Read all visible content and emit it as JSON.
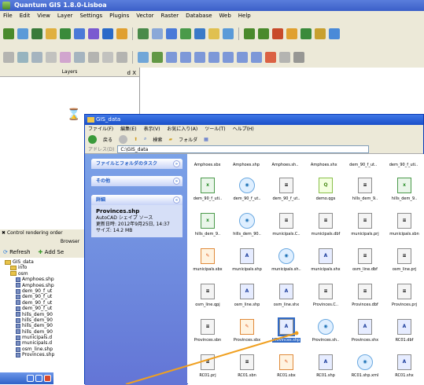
{
  "qgis": {
    "title": "Quantum GIS 1.8.0-Lisboa",
    "menu": [
      "File",
      "Edit",
      "View",
      "Layer",
      "Settings",
      "Plugins",
      "Vector",
      "Raster",
      "Database",
      "Web",
      "Help"
    ],
    "layers_title": "Layers",
    "layers_ctrl": "d X",
    "control_rendering": "Control rendering order",
    "browser_title": "Browser",
    "browser_refresh": "Refresh",
    "browser_add": "Add Se",
    "tree": [
      {
        "indent": 0,
        "label": "GIS_data",
        "kind": "folder"
      },
      {
        "indent": 1,
        "label": "info",
        "kind": "folder"
      },
      {
        "indent": 1,
        "label": "osm",
        "kind": "folder"
      },
      {
        "indent": 2,
        "label": "Amphoes.shp",
        "kind": "file"
      },
      {
        "indent": 2,
        "label": "Amphoes.shp",
        "kind": "file"
      },
      {
        "indent": 2,
        "label": "dem_90_f_ut",
        "kind": "file"
      },
      {
        "indent": 2,
        "label": "dem_90_f_ut",
        "kind": "file"
      },
      {
        "indent": 2,
        "label": "dem_90_f_ut",
        "kind": "file"
      },
      {
        "indent": 2,
        "label": "dem_90_f_ut",
        "kind": "file"
      },
      {
        "indent": 2,
        "label": "hills_dem_90",
        "kind": "file"
      },
      {
        "indent": 2,
        "label": "hills_dem_90",
        "kind": "file"
      },
      {
        "indent": 2,
        "label": "hills_dem_90",
        "kind": "file"
      },
      {
        "indent": 2,
        "label": "hills_dem_90",
        "kind": "file"
      },
      {
        "indent": 2,
        "label": "municipals.d",
        "kind": "file"
      },
      {
        "indent": 2,
        "label": "municipals.d",
        "kind": "file"
      },
      {
        "indent": 2,
        "label": "osm_line.shp",
        "kind": "file"
      },
      {
        "indent": 2,
        "label": "Provinces.shp",
        "kind": "file"
      }
    ]
  },
  "explorer": {
    "title": "GIS_data",
    "menu": [
      "ファイル(F)",
      "編集(E)",
      "表示(V)",
      "お気に入り(A)",
      "ツール(T)",
      "ヘルプ(H)"
    ],
    "nav": {
      "back": "戻る",
      "search": "検索",
      "folders": "フォルダ"
    },
    "address_label": "アドレス(D)",
    "address_value": "C:\\GIS_data",
    "tasks": {
      "file_folder": "ファイルとフォルダのタスク",
      "other": "その他",
      "details": "詳細",
      "details_name": "Provinces.shp",
      "details_type": "AutoCAD シェイプ ソース",
      "details_date": "更新日時: 2012年9月25日, 14:37",
      "details_size": "サイズ: 14.2 MB"
    },
    "top_labels": [
      "Amphoes.sbx",
      "Amphoes.shp",
      "Amphoes.sh..",
      "Amphoes.shx",
      "dem_90_f_ut..",
      "dem_90_f_uti.."
    ],
    "files": [
      {
        "label": "dem_90_f_uti..",
        "kind": "xml",
        "glyph": "x"
      },
      {
        "label": "dem_90_f_ut..",
        "kind": "globe",
        "glyph": "◉"
      },
      {
        "label": "dem_90_f_ut..",
        "kind": "doc",
        "glyph": "≡"
      },
      {
        "label": "demo.qgs",
        "kind": "qgs",
        "glyph": "Q"
      },
      {
        "label": "hills_dem_9..",
        "kind": "doc",
        "glyph": "≡"
      },
      {
        "label": "hills_dem_9..",
        "kind": "xml",
        "glyph": "x"
      },
      {
        "label": "hills_dem_9..",
        "kind": "xml",
        "glyph": "x"
      },
      {
        "label": "hills_dem_90..",
        "kind": "globe",
        "glyph": "◉"
      },
      {
        "label": "municipals.C..",
        "kind": "doc",
        "glyph": "≡"
      },
      {
        "label": "municipals.dbf",
        "kind": "doc",
        "glyph": "≡"
      },
      {
        "label": "municipals.prj",
        "kind": "doc",
        "glyph": "≡"
      },
      {
        "label": "municipals.sbn",
        "kind": "doc",
        "glyph": "≡"
      },
      {
        "label": "municipals.sbx",
        "kind": "sbx",
        "glyph": "✎"
      },
      {
        "label": "municipals.shp",
        "kind": "shp",
        "glyph": "A"
      },
      {
        "label": "municipals.sh..",
        "kind": "globe",
        "glyph": "◉"
      },
      {
        "label": "municipals.shx",
        "kind": "shp",
        "glyph": "A"
      },
      {
        "label": "osm_line.dbf",
        "kind": "doc",
        "glyph": "≡"
      },
      {
        "label": "osm_line.prj",
        "kind": "doc",
        "glyph": "≡"
      },
      {
        "label": "osm_line.qpj",
        "kind": "doc",
        "glyph": "≡"
      },
      {
        "label": "osm_line.shp",
        "kind": "shp",
        "glyph": "A"
      },
      {
        "label": "osm_line.shx",
        "kind": "shp",
        "glyph": "A"
      },
      {
        "label": "Provinces.C..",
        "kind": "doc",
        "glyph": "≡"
      },
      {
        "label": "Provinces.dbf",
        "kind": "doc",
        "glyph": "≡"
      },
      {
        "label": "Provinces.prj",
        "kind": "doc",
        "glyph": "≡"
      },
      {
        "label": "Provinces.sbn",
        "kind": "doc",
        "glyph": "≡"
      },
      {
        "label": "Provinces.sbx",
        "kind": "sbx",
        "glyph": "✎"
      },
      {
        "label": "Provinces.shp",
        "kind": "shp",
        "glyph": "A",
        "selected": true
      },
      {
        "label": "Provinces.sh..",
        "kind": "globe",
        "glyph": "◉"
      },
      {
        "label": "Provinces.shx",
        "kind": "shp",
        "glyph": "A"
      },
      {
        "label": "RC01.dbf",
        "kind": "shp",
        "glyph": "A"
      },
      {
        "label": "RC01.prj",
        "kind": "doc",
        "glyph": "≡"
      },
      {
        "label": "RC01.sbn",
        "kind": "doc",
        "glyph": "≡"
      },
      {
        "label": "RC01.sbx",
        "kind": "sbx",
        "glyph": "✎"
      },
      {
        "label": "RC01.shp",
        "kind": "shp",
        "glyph": "A"
      },
      {
        "label": "RC01.shp.xml",
        "kind": "globe",
        "glyph": "◉"
      },
      {
        "label": "RC01.shx",
        "kind": "shp",
        "glyph": "A"
      }
    ]
  },
  "colors": {
    "arrow": "#f0a020",
    "toolbar": "#ece9d8",
    "xp_blue": "#1a4fc9"
  }
}
